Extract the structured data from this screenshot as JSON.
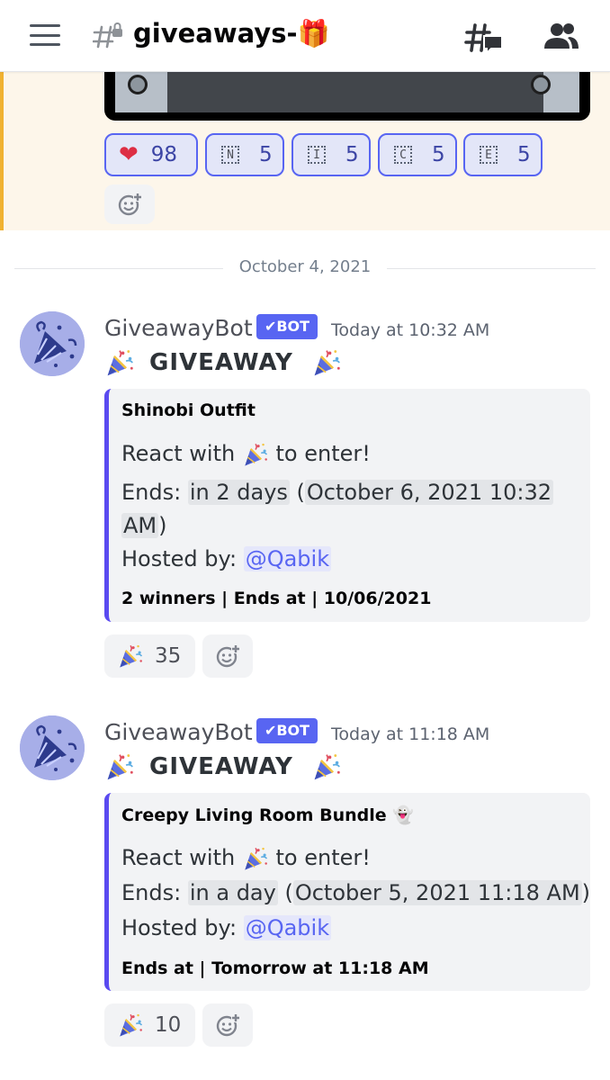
{
  "header": {
    "channel_name": "giveaways-🎁"
  },
  "previous_message": {
    "reactions": [
      {
        "emoji": "❤️",
        "count": "98"
      },
      {
        "letter": "N",
        "count": "5"
      },
      {
        "letter": "I",
        "count": "5"
      },
      {
        "letter": "C",
        "count": "5"
      },
      {
        "letter": "E",
        "count": "5"
      }
    ]
  },
  "divider": {
    "date": "October 4, 2021"
  },
  "messages": [
    {
      "username": "GiveawayBot",
      "bot_tag": "BOT",
      "timestamp": "Today at 10:32 AM",
      "heading": "GIVEAWAY",
      "embed": {
        "title": "Shinobi Outfit",
        "react_prefix": "React with",
        "react_suffix": "to enter!",
        "ends_label": "Ends:",
        "ends_relative": "in 2 days",
        "ends_paren_open": " (",
        "ends_absolute_a": "October 6, 2021 10:32",
        "ends_absolute_b": "AM",
        "ends_paren_close": ")",
        "hosted_label": "Hosted by:",
        "host": "@Qabik",
        "footer": "2 winners | Ends at | 10/06/2021"
      },
      "reaction_count": "35"
    },
    {
      "username": "GiveawayBot",
      "bot_tag": "BOT",
      "timestamp": "Today at 11:18 AM",
      "heading": "GIVEAWAY",
      "embed": {
        "title": "Creepy Living Room Bundle 👻",
        "react_prefix": "React with",
        "react_suffix": "to enter!",
        "ends_label": "Ends:",
        "ends_relative": "in a day",
        "ends_paren_open": " (",
        "ends_absolute": "October 5, 2021 11:18 AM",
        "ends_paren_close": ")",
        "hosted_label": "Hosted by:",
        "host": "@Qabik",
        "footer": "Ends at | Tomorrow at 11:18 AM"
      },
      "reaction_count": "10"
    }
  ],
  "colors": {
    "blurple": "#5865f2",
    "highlight_bg": "#fdf6ea",
    "highlight_bar": "#f0b232",
    "embed_border": "#5a4af0"
  },
  "icons": [
    "hamburger-icon",
    "locked-channel-icon",
    "threads-icon",
    "members-icon",
    "tada-icon",
    "add-reaction-icon",
    "checkmark-icon"
  ]
}
